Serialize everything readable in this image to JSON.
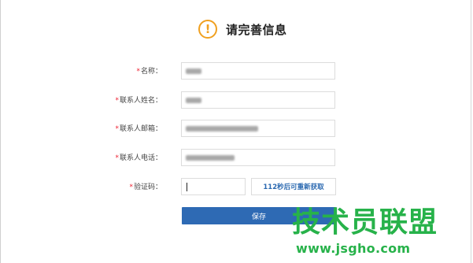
{
  "header": {
    "icon": "exclamation-circle-icon",
    "icon_glyph": "!",
    "title": "请完善信息"
  },
  "form": {
    "required_mark": "*",
    "fields": [
      {
        "label": "名称：",
        "value_blurred": true
      },
      {
        "label": "联系人姓名：",
        "value_blurred": true
      },
      {
        "label": "联系人邮箱：",
        "value_blurred": true
      },
      {
        "label": "联系人电话：",
        "value_blurred": true
      }
    ],
    "verify": {
      "label": "验证码：",
      "value": "",
      "resend_label": "112秒后可重新获取"
    },
    "save_label": "保存"
  },
  "watermark": {
    "text": "技术员联盟",
    "url": "www.jsgho.com"
  },
  "colors": {
    "accent_warning": "#f0a020",
    "primary_button": "#2e6ab4",
    "required": "#ee2233",
    "watermark": "#27b24a"
  }
}
